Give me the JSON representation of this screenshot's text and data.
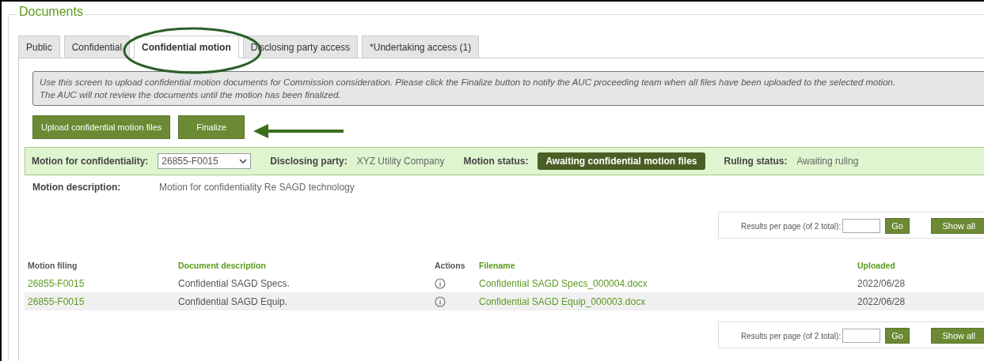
{
  "section_title": "Documents",
  "tabs": [
    {
      "label": "Public",
      "selected": false
    },
    {
      "label": "Confidential",
      "selected": false
    },
    {
      "label": "Confidential motion",
      "selected": true
    },
    {
      "label": "Disclosing party access",
      "selected": false
    },
    {
      "label": "*Undertaking access (1)",
      "selected": false
    }
  ],
  "notice": [
    "Use this screen to upload confidential motion documents for Commission consideration. Please click the Finalize button to notify the AUC proceeding team when all files have been uploaded to the selected motion.",
    "The AUC will not review the documents until the motion has been finalized."
  ],
  "actions": [
    "Upload confidential motion files",
    "Finalize"
  ],
  "motion_bar": {
    "motion_label": "Motion for confidentiality:",
    "motion_value": "26855-F0015",
    "party_label": "Disclosing party:",
    "party_value": "XYZ Utility Company",
    "status_label": "Motion status:",
    "status_value": "Awaiting confidential motion files",
    "ruling_label": "Ruling status:",
    "ruling_value": "Awaiting ruling"
  },
  "description": {
    "label": "Motion description:",
    "value": "Motion for confidentiality Re SAGD technology"
  },
  "pager": {
    "label": "Results per page (of 2 total):",
    "go": "Go",
    "show_all": "Show all"
  },
  "table": {
    "columns": [
      {
        "label": "Motion filing",
        "sortable": false
      },
      {
        "label": "Document description",
        "sortable": true
      },
      {
        "label": "Actions",
        "sortable": false
      },
      {
        "label": "Filename",
        "sortable": true
      },
      {
        "label": "Uploaded",
        "sortable": true
      }
    ],
    "rows": [
      {
        "filing": "26855-F0015",
        "description": "Confidential SAGD Specs.",
        "filename": "Confidential SAGD Specs_000004.docx",
        "uploaded": "2022/06/28"
      },
      {
        "filing": "26855-F0015",
        "description": "Confidential SAGD Equip.",
        "filename": "Confidential SAGD Equip_000003.docx",
        "uploaded": "2022/06/28"
      }
    ]
  },
  "pager_bottom": {
    "label": "Results per page (of 2 total):",
    "go": "Go",
    "show_all": "Show all"
  }
}
